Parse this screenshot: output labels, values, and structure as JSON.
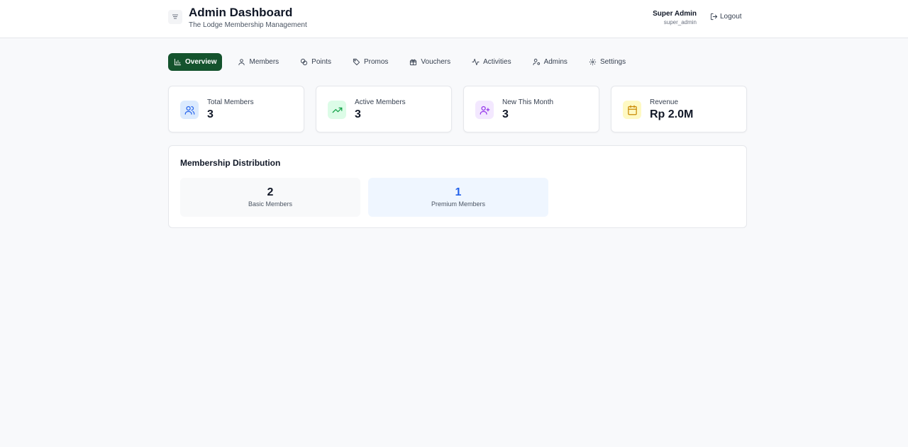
{
  "header": {
    "title": "Admin Dashboard",
    "subtitle": "The Lodge Membership Management",
    "user_name": "Super Admin",
    "user_role": "super_admin",
    "logout_label": "Logout"
  },
  "nav": {
    "tabs": [
      {
        "label": "Overview",
        "icon": "bar-chart-icon",
        "active": true
      },
      {
        "label": "Members",
        "icon": "user-icon"
      },
      {
        "label": "Points",
        "icon": "coins-icon"
      },
      {
        "label": "Promos",
        "icon": "tag-icon"
      },
      {
        "label": "Vouchers",
        "icon": "gift-icon"
      },
      {
        "label": "Activities",
        "icon": "activity-icon"
      },
      {
        "label": "Admins",
        "icon": "user-cog-icon"
      },
      {
        "label": "Settings",
        "icon": "gear-icon"
      }
    ]
  },
  "stats": [
    {
      "label": "Total Members",
      "value": "3",
      "icon": "users-icon",
      "color": "#2563eb",
      "bg": "#dbeafe"
    },
    {
      "label": "Active Members",
      "value": "3",
      "icon": "trending-up-icon",
      "color": "#16a34a",
      "bg": "#dcfce7"
    },
    {
      "label": "New This Month",
      "value": "3",
      "icon": "user-plus-icon",
      "color": "#9333ea",
      "bg": "#f3e8ff"
    },
    {
      "label": "Revenue",
      "value": "Rp 2.0M",
      "icon": "calendar-icon",
      "color": "#ca8a04",
      "bg": "#fef9c3"
    }
  ],
  "distribution": {
    "title": "Membership Distribution",
    "basic": {
      "count": "2",
      "label": "Basic Members"
    },
    "premium": {
      "count": "1",
      "label": "Premium Members"
    }
  },
  "colors": {
    "accent": "#14532d",
    "premium": "#2563eb"
  }
}
